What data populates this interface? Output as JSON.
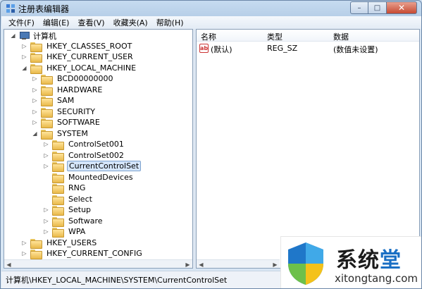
{
  "window": {
    "title": "注册表编辑器"
  },
  "caption_buttons": {
    "minimize": "–",
    "maximize": "□",
    "close": "✕"
  },
  "menu": [
    "文件(F)",
    "编辑(E)",
    "查看(V)",
    "收藏夹(A)",
    "帮助(H)"
  ],
  "tree": {
    "root": "计算机",
    "hives": {
      "hkcr": "HKEY_CLASSES_ROOT",
      "hkcu": "HKEY_CURRENT_USER",
      "hklm": "HKEY_LOCAL_MACHINE",
      "hku": "HKEY_USERS",
      "hkcc": "HKEY_CURRENT_CONFIG"
    },
    "hklm_children": [
      "BCD00000000",
      "HARDWARE",
      "SAM",
      "SECURITY",
      "SOFTWARE",
      "SYSTEM"
    ],
    "system_children": [
      "ControlSet001",
      "ControlSet002",
      "CurrentControlSet",
      "MountedDevices",
      "RNG",
      "Select",
      "Setup",
      "Software",
      "WPA"
    ],
    "selected": "CurrentControlSet"
  },
  "list": {
    "columns": {
      "name": "名称",
      "type": "类型",
      "data": "数据"
    },
    "rows": [
      {
        "icon": "string-value-icon",
        "name": "(默认)",
        "type": "REG_SZ",
        "data": "(数值未设置)"
      }
    ]
  },
  "status": "计算机\\HKEY_LOCAL_MACHINE\\SYSTEM\\CurrentControlSet",
  "watermark": {
    "brand_main": "系统",
    "brand_accent": "堂",
    "url": "xitongtang.com"
  }
}
